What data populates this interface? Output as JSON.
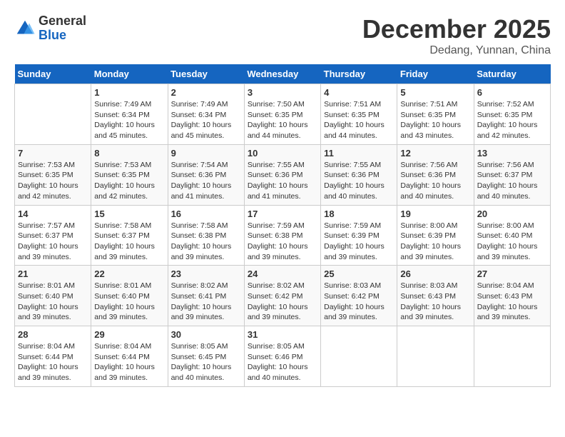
{
  "header": {
    "logo_general": "General",
    "logo_blue": "Blue",
    "month_title": "December 2025",
    "location": "Dedang, Yunnan, China"
  },
  "days_of_week": [
    "Sunday",
    "Monday",
    "Tuesday",
    "Wednesday",
    "Thursday",
    "Friday",
    "Saturday"
  ],
  "weeks": [
    [
      {
        "num": "",
        "sunrise": "",
        "sunset": "",
        "daylight": ""
      },
      {
        "num": "1",
        "sunrise": "Sunrise: 7:49 AM",
        "sunset": "Sunset: 6:34 PM",
        "daylight": "Daylight: 10 hours and 45 minutes."
      },
      {
        "num": "2",
        "sunrise": "Sunrise: 7:49 AM",
        "sunset": "Sunset: 6:34 PM",
        "daylight": "Daylight: 10 hours and 45 minutes."
      },
      {
        "num": "3",
        "sunrise": "Sunrise: 7:50 AM",
        "sunset": "Sunset: 6:35 PM",
        "daylight": "Daylight: 10 hours and 44 minutes."
      },
      {
        "num": "4",
        "sunrise": "Sunrise: 7:51 AM",
        "sunset": "Sunset: 6:35 PM",
        "daylight": "Daylight: 10 hours and 44 minutes."
      },
      {
        "num": "5",
        "sunrise": "Sunrise: 7:51 AM",
        "sunset": "Sunset: 6:35 PM",
        "daylight": "Daylight: 10 hours and 43 minutes."
      },
      {
        "num": "6",
        "sunrise": "Sunrise: 7:52 AM",
        "sunset": "Sunset: 6:35 PM",
        "daylight": "Daylight: 10 hours and 42 minutes."
      }
    ],
    [
      {
        "num": "7",
        "sunrise": "Sunrise: 7:53 AM",
        "sunset": "Sunset: 6:35 PM",
        "daylight": "Daylight: 10 hours and 42 minutes."
      },
      {
        "num": "8",
        "sunrise": "Sunrise: 7:53 AM",
        "sunset": "Sunset: 6:35 PM",
        "daylight": "Daylight: 10 hours and 42 minutes."
      },
      {
        "num": "9",
        "sunrise": "Sunrise: 7:54 AM",
        "sunset": "Sunset: 6:36 PM",
        "daylight": "Daylight: 10 hours and 41 minutes."
      },
      {
        "num": "10",
        "sunrise": "Sunrise: 7:55 AM",
        "sunset": "Sunset: 6:36 PM",
        "daylight": "Daylight: 10 hours and 41 minutes."
      },
      {
        "num": "11",
        "sunrise": "Sunrise: 7:55 AM",
        "sunset": "Sunset: 6:36 PM",
        "daylight": "Daylight: 10 hours and 40 minutes."
      },
      {
        "num": "12",
        "sunrise": "Sunrise: 7:56 AM",
        "sunset": "Sunset: 6:36 PM",
        "daylight": "Daylight: 10 hours and 40 minutes."
      },
      {
        "num": "13",
        "sunrise": "Sunrise: 7:56 AM",
        "sunset": "Sunset: 6:37 PM",
        "daylight": "Daylight: 10 hours and 40 minutes."
      }
    ],
    [
      {
        "num": "14",
        "sunrise": "Sunrise: 7:57 AM",
        "sunset": "Sunset: 6:37 PM",
        "daylight": "Daylight: 10 hours and 39 minutes."
      },
      {
        "num": "15",
        "sunrise": "Sunrise: 7:58 AM",
        "sunset": "Sunset: 6:37 PM",
        "daylight": "Daylight: 10 hours and 39 minutes."
      },
      {
        "num": "16",
        "sunrise": "Sunrise: 7:58 AM",
        "sunset": "Sunset: 6:38 PM",
        "daylight": "Daylight: 10 hours and 39 minutes."
      },
      {
        "num": "17",
        "sunrise": "Sunrise: 7:59 AM",
        "sunset": "Sunset: 6:38 PM",
        "daylight": "Daylight: 10 hours and 39 minutes."
      },
      {
        "num": "18",
        "sunrise": "Sunrise: 7:59 AM",
        "sunset": "Sunset: 6:39 PM",
        "daylight": "Daylight: 10 hours and 39 minutes."
      },
      {
        "num": "19",
        "sunrise": "Sunrise: 8:00 AM",
        "sunset": "Sunset: 6:39 PM",
        "daylight": "Daylight: 10 hours and 39 minutes."
      },
      {
        "num": "20",
        "sunrise": "Sunrise: 8:00 AM",
        "sunset": "Sunset: 6:40 PM",
        "daylight": "Daylight: 10 hours and 39 minutes."
      }
    ],
    [
      {
        "num": "21",
        "sunrise": "Sunrise: 8:01 AM",
        "sunset": "Sunset: 6:40 PM",
        "daylight": "Daylight: 10 hours and 39 minutes."
      },
      {
        "num": "22",
        "sunrise": "Sunrise: 8:01 AM",
        "sunset": "Sunset: 6:40 PM",
        "daylight": "Daylight: 10 hours and 39 minutes."
      },
      {
        "num": "23",
        "sunrise": "Sunrise: 8:02 AM",
        "sunset": "Sunset: 6:41 PM",
        "daylight": "Daylight: 10 hours and 39 minutes."
      },
      {
        "num": "24",
        "sunrise": "Sunrise: 8:02 AM",
        "sunset": "Sunset: 6:42 PM",
        "daylight": "Daylight: 10 hours and 39 minutes."
      },
      {
        "num": "25",
        "sunrise": "Sunrise: 8:03 AM",
        "sunset": "Sunset: 6:42 PM",
        "daylight": "Daylight: 10 hours and 39 minutes."
      },
      {
        "num": "26",
        "sunrise": "Sunrise: 8:03 AM",
        "sunset": "Sunset: 6:43 PM",
        "daylight": "Daylight: 10 hours and 39 minutes."
      },
      {
        "num": "27",
        "sunrise": "Sunrise: 8:04 AM",
        "sunset": "Sunset: 6:43 PM",
        "daylight": "Daylight: 10 hours and 39 minutes."
      }
    ],
    [
      {
        "num": "28",
        "sunrise": "Sunrise: 8:04 AM",
        "sunset": "Sunset: 6:44 PM",
        "daylight": "Daylight: 10 hours and 39 minutes."
      },
      {
        "num": "29",
        "sunrise": "Sunrise: 8:04 AM",
        "sunset": "Sunset: 6:44 PM",
        "daylight": "Daylight: 10 hours and 39 minutes."
      },
      {
        "num": "30",
        "sunrise": "Sunrise: 8:05 AM",
        "sunset": "Sunset: 6:45 PM",
        "daylight": "Daylight: 10 hours and 40 minutes."
      },
      {
        "num": "31",
        "sunrise": "Sunrise: 8:05 AM",
        "sunset": "Sunset: 6:46 PM",
        "daylight": "Daylight: 10 hours and 40 minutes."
      },
      {
        "num": "",
        "sunrise": "",
        "sunset": "",
        "daylight": ""
      },
      {
        "num": "",
        "sunrise": "",
        "sunset": "",
        "daylight": ""
      },
      {
        "num": "",
        "sunrise": "",
        "sunset": "",
        "daylight": ""
      }
    ]
  ]
}
